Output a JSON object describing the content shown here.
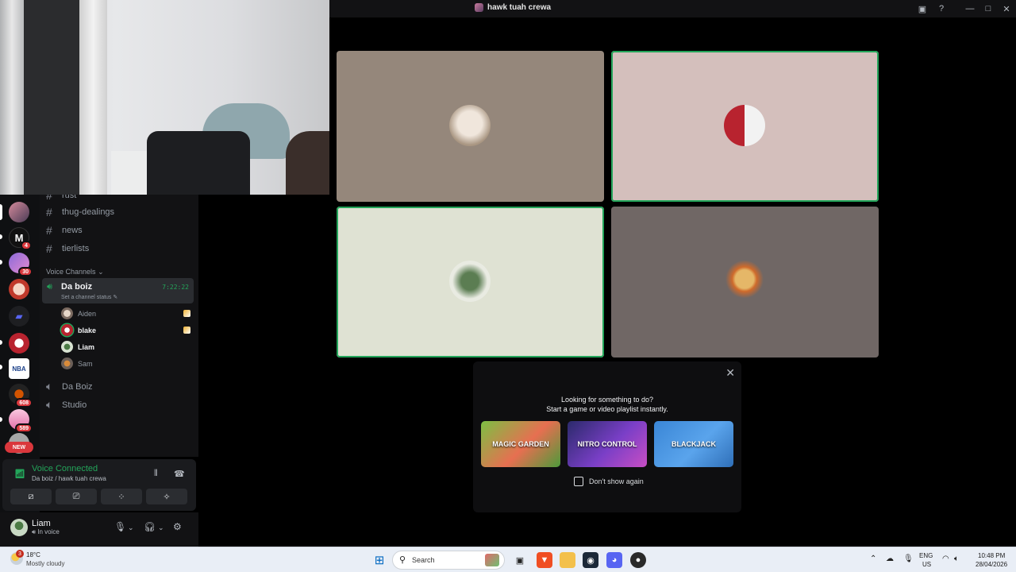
{
  "window": {
    "title": "hawk tuah crewa"
  },
  "channels": {
    "partial_top": "rust",
    "text": [
      "thug-dealings",
      "news",
      "tierlists"
    ],
    "voice_category": "Voice Channels",
    "active_voice": {
      "name": "Da boiz",
      "status_placeholder": "Set a channel status",
      "timer": "7:22:22"
    },
    "voice_users": [
      "Aiden",
      "blake",
      "Liam",
      "Sam"
    ],
    "other_voice": [
      "Da Boiz",
      "Studio"
    ]
  },
  "servers": {
    "badges": [
      "4",
      "30",
      "608",
      "589"
    ],
    "new_label": "NEW"
  },
  "voice_panel": {
    "title": "Voice Connected",
    "subtitle": "Da boiz / hawk tuah crewa"
  },
  "user": {
    "name": "Liam",
    "state": "In voice"
  },
  "popup": {
    "line1": "Looking for something to do?",
    "line2": "Start a game or video playlist instantly.",
    "activities": [
      "MAGIC GARDEN",
      "NITRO CONTROL",
      "BLACKJACK"
    ],
    "checkbox_label": "Don't show again"
  },
  "taskbar": {
    "temp": "18°C",
    "condition": "Mostly cloudy",
    "weather_badge": "3",
    "search_label": "Search",
    "lang1": "ENG",
    "lang2": "US",
    "time": "10:48 PM",
    "date": "28/04/2026"
  },
  "colors": {
    "speaking": "#23a55a",
    "badge": "#da373c",
    "background": "#000000",
    "panel": "#121214"
  }
}
